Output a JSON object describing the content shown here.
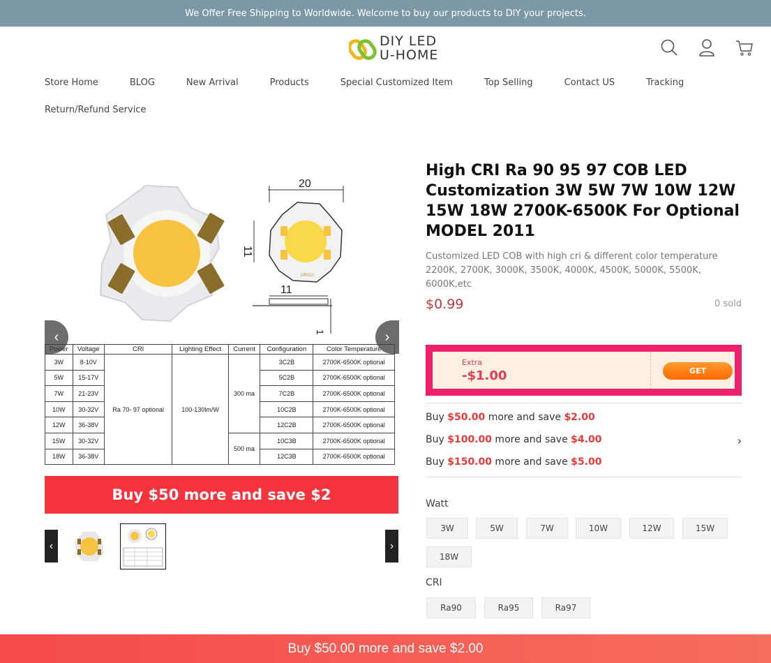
{
  "announcement": "We Offer Free Shipping to Worldwide. Welcome to buy our products to DIY your projects.",
  "logo": {
    "line1": "DIY LED",
    "line2": "U-HOME",
    "icon": "chain-link-logo-icon"
  },
  "header_icons": [
    "search-icon",
    "user-icon",
    "cart-icon"
  ],
  "nav": {
    "row1": [
      "Store Home",
      "BLOG",
      "New Arrival",
      "Products",
      "Special Customized Item",
      "Top Selling",
      "Contact US",
      "Tracking"
    ],
    "row2": [
      "Return/Refund Service"
    ]
  },
  "gallery": {
    "dim_top": "20",
    "dim_side": "11",
    "dim_bottom": "11",
    "dim_right": "1",
    "chip_marking": "DR010",
    "table_headers": [
      "Power",
      "Voltage",
      "CRI",
      "Lighting Effect",
      "Current",
      "Configuration",
      "Color Temperature"
    ],
    "rows": [
      [
        "3W",
        "8-10V",
        "3C2B",
        "2700K-6500K optional"
      ],
      [
        "5W",
        "15-17V",
        "5C2B",
        "2700K-6500K optional"
      ],
      [
        "7W",
        "21-23V",
        "7C2B",
        "2700K-6500K optional"
      ],
      [
        "10W",
        "30-32V",
        "10C2B",
        "2700K-6500K optional"
      ],
      [
        "12W",
        "36-38V",
        "12C2B",
        "2700K-6500K optional"
      ],
      [
        "15W",
        "30-32V",
        "10C3B",
        "2700K-6500K optional"
      ],
      [
        "18W",
        "36-38V",
        "12C3B",
        "2700K-6500K optional"
      ]
    ],
    "cri_merged": "Ra 70- 97 optional",
    "effect_merged": "100-130lm/W",
    "current_300": "300 ma",
    "current_500": "500 ma",
    "banner": "Buy $50 more and save $2"
  },
  "product": {
    "title": "High CRI Ra 90 95 97 COB LED Customization 3W 5W 7W 10W 12W 15W 18W 2700K-6500K For Optional MODEL 2011",
    "subtitle": "Customized LED COB with high cri & different color temperature 2200K, 2700K, 3000K, 3500K, 4000K, 4500K, 5000K, 5500K, 6000K,etc",
    "price": "$0.99",
    "sold": "0 sold"
  },
  "coupon": {
    "extra": "Extra",
    "amount": "-$1.00",
    "button": "GET"
  },
  "tiers": [
    {
      "pre": "Buy ",
      "amt": "$50.00",
      "mid": " more and save ",
      "save": "$2.00"
    },
    {
      "pre": "Buy ",
      "amt": "$100.00",
      "mid": " more and save ",
      "save": "$4.00"
    },
    {
      "pre": "Buy ",
      "amt": "$150.00",
      "mid": " more and save ",
      "save": "$5.00"
    }
  ],
  "options": {
    "watt_label": "Watt",
    "watt": [
      "3W",
      "5W",
      "7W",
      "10W",
      "12W",
      "15W",
      "18W"
    ],
    "cri_label": "CRI",
    "cri": [
      "Ra90",
      "Ra95",
      "Ra97"
    ]
  },
  "sticky_bar": "Buy $50.00 more and save $2.00",
  "colors": {
    "announce_bg": "#7c98a7",
    "price": "#b83a3e",
    "coupon_bg": "#ee1f6b",
    "accent_red": "#e83a3a",
    "banner_red": "#f5333c"
  }
}
